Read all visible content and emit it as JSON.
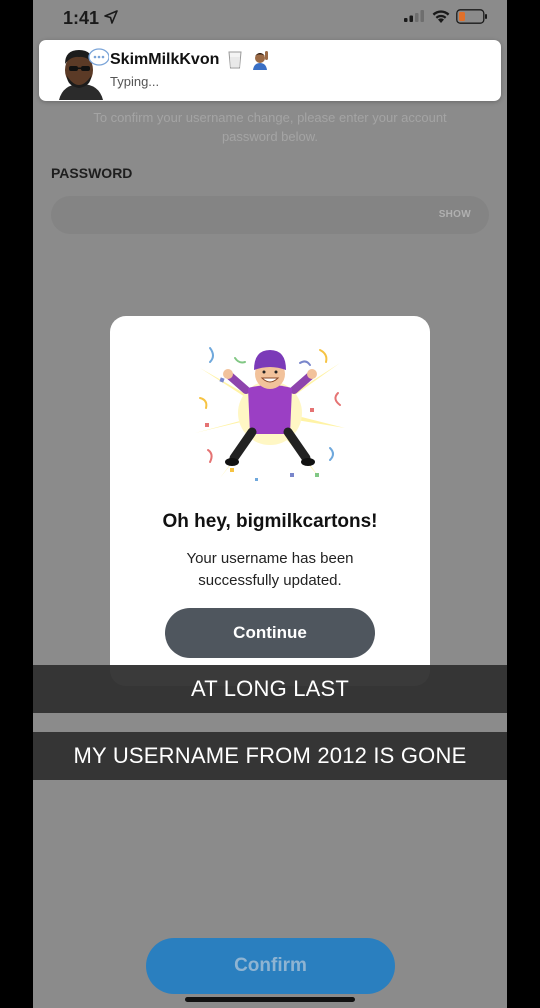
{
  "status_bar": {
    "time": "1:41"
  },
  "notification": {
    "name": "SkimMilkKvon",
    "status": "Typing..."
  },
  "screen": {
    "instructions": "To confirm your username change, please enter your account password below.",
    "password_label": "PASSWORD",
    "password_placeholder": "",
    "show_label": "SHOW",
    "confirm_label": "Confirm"
  },
  "modal": {
    "title": "Oh hey, bigmilkcartons!",
    "message": "Your username has been\nsuccessfully updated.",
    "continue_label": "Continue"
  },
  "captions": [
    "AT LONG LAST",
    "MY USERNAME FROM 2012 IS GONE"
  ],
  "colors": {
    "confirm": "#2a7fbf",
    "continue": "#4f565e",
    "overlay": "#8b8b8b"
  }
}
